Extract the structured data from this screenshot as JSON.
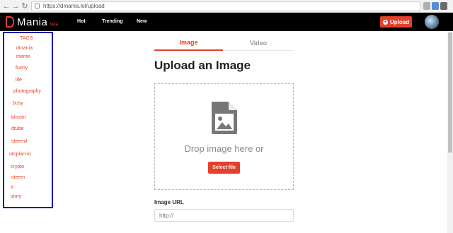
{
  "browser": {
    "url": "https://dmania.lol/upload"
  },
  "header": {
    "logo_text": "Mania",
    "logo_badge": "beta",
    "nav": [
      "Hot",
      "Trending",
      "New"
    ],
    "upload_label": "Upload"
  },
  "sidebar": {
    "title": "TAGS",
    "tags": [
      "dmania",
      "meme",
      "funny",
      "life",
      "photography",
      "busy",
      "bitcoin",
      "dtube",
      "steemit",
      "utopian-io",
      "crypto",
      "steem",
      "tr",
      "story"
    ]
  },
  "main": {
    "tabs": [
      "Image",
      "Video"
    ],
    "active_tab": "Image",
    "title": "Upload an Image",
    "drop_text": "Drop image here or",
    "select_file_label": "Select file",
    "url_label": "Image URL",
    "url_placeholder": "http://"
  },
  "colors": {
    "accent": "#e4402b",
    "header_bg": "#000000",
    "sidebar_border": "#1a1aa8"
  }
}
